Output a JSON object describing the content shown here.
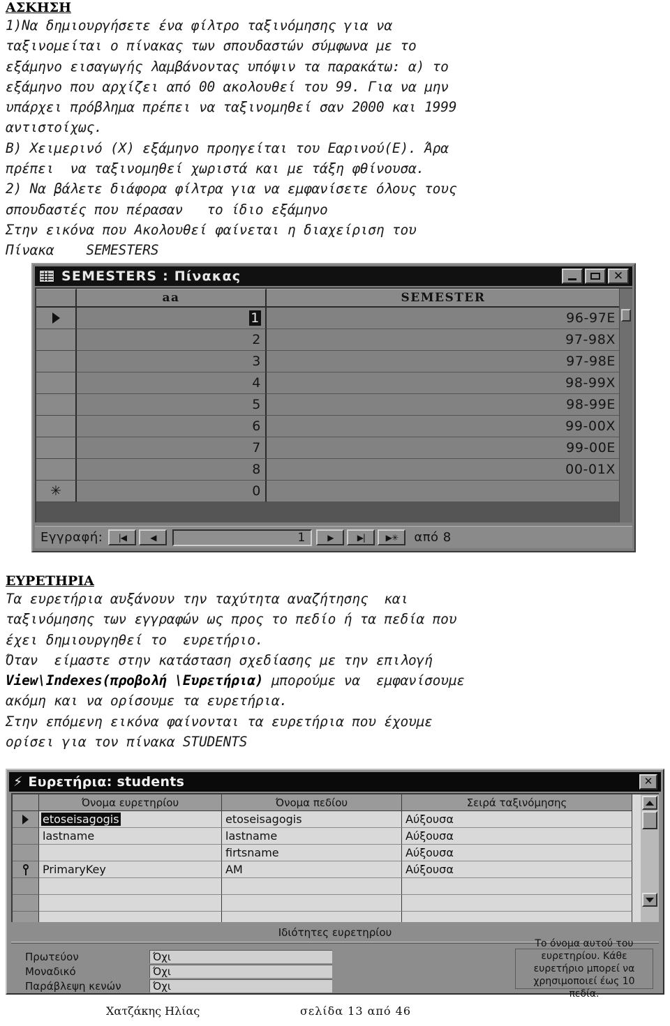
{
  "document": {
    "heading1": "ΑΣΚΗΣΗ",
    "para1": "1)Να δημιουργήσετε ένα φίλτρο ταξινόμησης για να\nταξινομείται ο πίνακας των σπουδαστών σύμφωνα με το\nεξάμηνο εισαγωγής λαμβάνοντας υπόψιν τα παρακάτω: α) το\nεξάμηνο που αρχίζει από 00 ακολουθεί του 99. Για να μην\nυπάρχει πρόβλημα πρέπει να ταξινομηθεί σαν 2000 και 1999\nαντιστοίχως.\nΒ) Χειμερινό (Χ) εξάμηνο προηγείται του Εαρινού(Ε). Άρα\nπρέπει  να ταξινομηθεί χωριστά και με τάξη φθίνουσα.\n2) Να βάλετε διάφορα φίλτρα για να εμφανίσετε όλους τους\nσπουδαστές που πέρασαν   το ίδιο εξάμηνο\nΣτην εικόνα που Ακολουθεί φαίνεται η διαχείριση του\nΠίνακα    SEMESTERS",
    "heading2": "ΕΥΡΕΤΗΡΙΑ",
    "para2a": "Τα ευρετήρια αυξάνουν την ταχύτητα αναζήτησης  και\nταξινόμησης των εγγραφών ως προς το πεδίο ή τα πεδία που\nέχει δημιουργηθεί το  ευρετήριο.\nΌταν  είμαστε στην κατάσταση σχεδίασης με την επιλογή\n",
    "para2bold": "View\\Indexes(προβολή \\Ευρετήρια)",
    "para2b": " μπορούμε να  εμφανίσουμε\nακόμη και να ορίσουμε τα ευρετήρια.\nΣτην επόμενη εικόνα φαίνονται τα ευρετήρια που έχουμε\nορίσει για τον πίνακα STUDENTS"
  },
  "semesters_window": {
    "title": "SEMESTERS : Πίνακας",
    "sysicon": "datasheet-icon",
    "buttons": {
      "minimize": "_",
      "maximize": "□",
      "close": "✕"
    },
    "columns": [
      "aa",
      "SEMESTER"
    ],
    "rows": [
      {
        "selector": "current",
        "aa": "1",
        "semester": "96-97E"
      },
      {
        "selector": "",
        "aa": "2",
        "semester": "97-98X"
      },
      {
        "selector": "",
        "aa": "3",
        "semester": "97-98E"
      },
      {
        "selector": "",
        "aa": "4",
        "semester": "98-99X"
      },
      {
        "selector": "",
        "aa": "5",
        "semester": "98-99E"
      },
      {
        "selector": "",
        "aa": "6",
        "semester": "99-00X"
      },
      {
        "selector": "",
        "aa": "7",
        "semester": "99-00E"
      },
      {
        "selector": "",
        "aa": "8",
        "semester": "00-01X"
      },
      {
        "selector": "new",
        "aa": "0",
        "semester": ""
      }
    ],
    "nav": {
      "label": "Εγγραφή:",
      "first": "|◀",
      "prev": "◀",
      "current": "1",
      "next": "▶",
      "last": "▶|",
      "new": "▶✳",
      "total": "από 8"
    }
  },
  "indexes_window": {
    "title": "Ευρετήρια: students",
    "sysicon": "lightning-icon",
    "close": "✕",
    "columns": [
      "Όνομα ευρετηρίου",
      "Όνομα πεδίου",
      "Σειρά ταξινόμησης"
    ],
    "rows": [
      {
        "selector": "current",
        "index_name": "etoseisagogis",
        "field_name": "etoseisagogis",
        "sort_order": "Αύξουσα"
      },
      {
        "selector": "",
        "index_name": "lastname",
        "field_name": "lastname",
        "sort_order": "Αύξουσα"
      },
      {
        "selector": "",
        "index_name": "",
        "field_name": "firtsname",
        "sort_order": "Αύξουσα"
      },
      {
        "selector": "key",
        "index_name": "PrimaryKey",
        "field_name": "AM",
        "sort_order": "Αύξουσα"
      },
      {
        "selector": "",
        "index_name": "",
        "field_name": "",
        "sort_order": ""
      },
      {
        "selector": "",
        "index_name": "",
        "field_name": "",
        "sort_order": ""
      },
      {
        "selector": "",
        "index_name": "",
        "field_name": "",
        "sort_order": ""
      }
    ],
    "properties_title": "Ιδιότητες ευρετηρίου",
    "properties": [
      {
        "label": "Πρωτεύον",
        "value": "Όχι"
      },
      {
        "label": "Μοναδικό",
        "value": "Όχι"
      },
      {
        "label": "Παράβλεψη κενών",
        "value": "Όχι"
      }
    ],
    "help_text": "Το όνομα αυτού του ευρετηρίου. Κάθε ευρετήριο μπορεί να χρησιμοποιεί έως 10 πεδία."
  },
  "footer": {
    "author": "Χατζάκης Ηλίας",
    "page": "σελίδα  13  από  46"
  }
}
